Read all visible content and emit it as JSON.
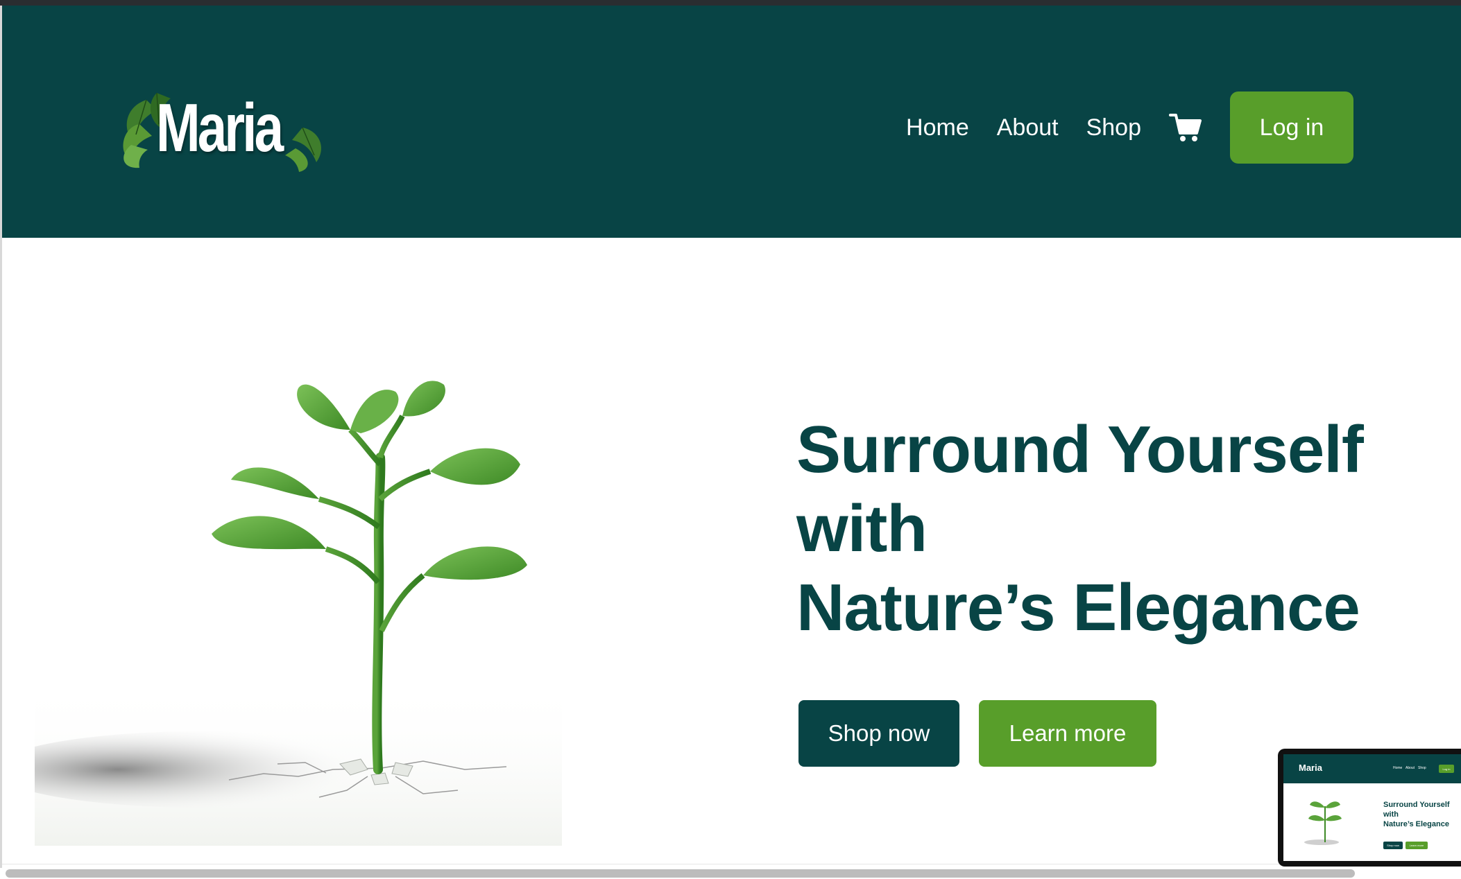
{
  "header": {
    "logo_text": "Maria",
    "nav": [
      "Home",
      "About",
      "Shop"
    ],
    "cart_icon": "shopping-cart-icon",
    "login_label": "Log in"
  },
  "hero": {
    "title_lines": [
      "Surround Yourself",
      "with",
      "Nature’s Elegance"
    ],
    "primary_button": "Shop now",
    "secondary_button": "Learn more",
    "image": "seedling-illustration"
  },
  "colors": {
    "header_bg": "#084445",
    "accent_green": "#589e2a",
    "title_color": "#084445"
  }
}
